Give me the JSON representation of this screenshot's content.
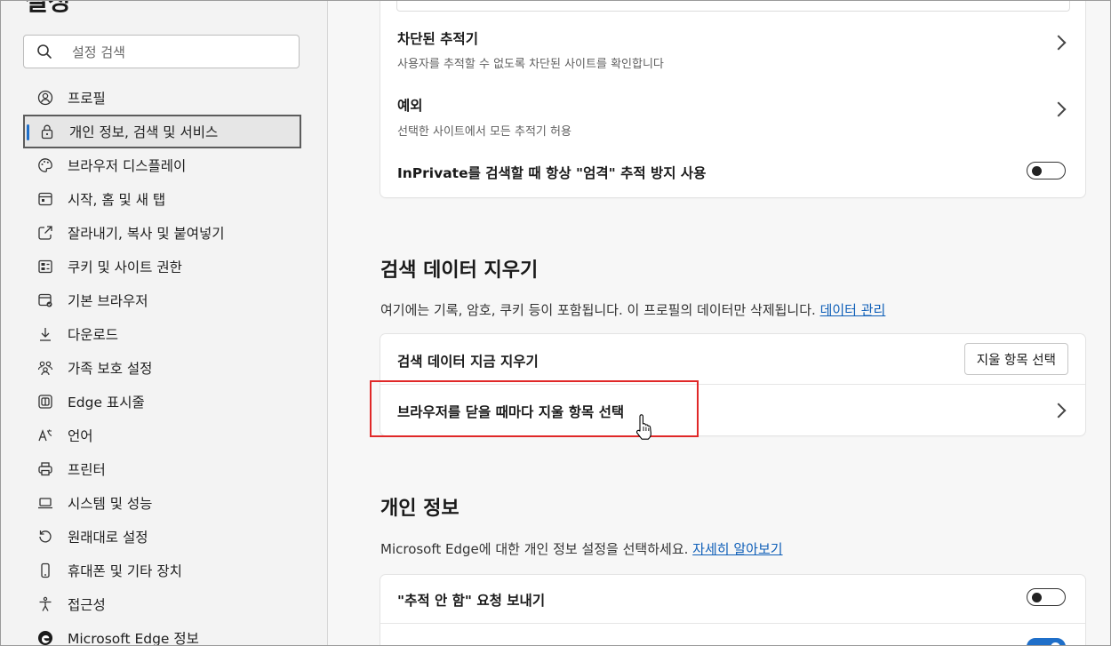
{
  "sidebar": {
    "title": "설정",
    "search_placeholder": "설정 검색",
    "items": [
      {
        "label": "프로필",
        "icon": "profile-icon"
      },
      {
        "label": "개인 정보, 검색 및 서비스",
        "icon": "lock-icon",
        "active": true
      },
      {
        "label": "브라우저 디스플레이",
        "icon": "palette-icon"
      },
      {
        "label": "시작, 홈 및 새 탭",
        "icon": "home-tab-icon"
      },
      {
        "label": "잘라내기, 복사 및 붙여넣기",
        "icon": "share-icon"
      },
      {
        "label": "쿠키 및 사이트 권한",
        "icon": "cookie-icon"
      },
      {
        "label": "기본 브라우저",
        "icon": "browser-icon"
      },
      {
        "label": "다운로드",
        "icon": "download-icon"
      },
      {
        "label": "가족 보호 설정",
        "icon": "family-icon"
      },
      {
        "label": "Edge 표시줄",
        "icon": "edge-bar-icon"
      },
      {
        "label": "언어",
        "icon": "language-icon"
      },
      {
        "label": "프린터",
        "icon": "printer-icon"
      },
      {
        "label": "시스템 및 성능",
        "icon": "laptop-icon"
      },
      {
        "label": "원래대로 설정",
        "icon": "reset-icon"
      },
      {
        "label": "휴대폰 및 기타 장치",
        "icon": "phone-icon"
      },
      {
        "label": "접근성",
        "icon": "accessibility-icon"
      },
      {
        "label": "Microsoft Edge 정보",
        "icon": "edge-logo-icon"
      }
    ]
  },
  "tracking": {
    "blocked_title": "차단된 추적기",
    "blocked_sub": "사용자를 추적할 수 없도록 차단된 사이트를 확인합니다",
    "exceptions_title": "예외",
    "exceptions_sub": "선택한 사이트에서 모든 추적기 허용",
    "inprivate_label": "InPrivate를 검색할 때 항상 \"엄격\" 추적 방지 사용"
  },
  "clear_data": {
    "title": "검색 데이터 지우기",
    "desc": "여기에는 기록, 암호, 쿠키 등이 포함됩니다. 이 프로필의 데이터만 삭제됩니다.",
    "desc_link": "데이터 관리",
    "clear_now_label": "검색 데이터 지금 지우기",
    "choose_button": "지울 항목 선택",
    "on_close_label": "브라우저를 닫을 때마다 지울 항목 선택"
  },
  "privacy": {
    "title": "개인 정보",
    "desc": "Microsoft Edge에 대한 개인 정보 설정을 선택하세요.",
    "desc_link": "자세히 알아보기",
    "dnt_label": "\"추적 안 함\" 요청 보내기"
  }
}
